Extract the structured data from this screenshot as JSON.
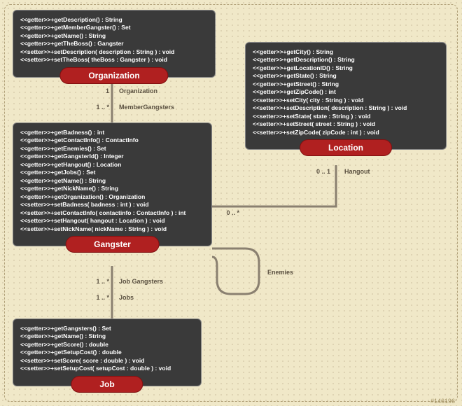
{
  "classes": {
    "organization": {
      "name": "Organization",
      "methods": [
        "<<getter>>+getDescription() : String",
        "<<getter>>+getMemberGangster() : Set",
        "<<getter>>+getName() : String",
        "<<getter>>+getTheBoss() : Gangster",
        "<<setter>>+setDescription( description : String ) : void",
        "<<setter>>+setTheBoss( theBoss : Gangster ) : void"
      ]
    },
    "gangster": {
      "name": "Gangster",
      "methods": [
        "<<getter>>+getBadness() : int",
        "<<getter>>+getContactInfo() : ContactInfo",
        "<<getter>>+getEnemies() : Set",
        "<<getter>>+getGangsterId() : Integer",
        "<<getter>>+getHangout() : Location",
        "<<getter>>+getJobs() : Set",
        "<<getter>>+getName() : String",
        "<<getter>>+getNickName() : String",
        "<<getter>>+getOrganization() : Organization",
        "<<setter>>+setBadness( badness : int ) : void",
        "<<setter>>+setContactInfo( contactinfo : ContactInfo ) : int",
        "<<setter>>+setHangout( hangout : Location ) : void",
        "<<setter>>+setNickName( nickName : String ) : void"
      ]
    },
    "location": {
      "name": "Location",
      "methods": [
        "<<getter>>+getCity() : String",
        "<<getter>>+getDescription() : String",
        "<<getter>>+getLocationID() : String",
        "<<getter>>+getState() : String",
        "<<getter>>+getStreet() : String",
        "<<getter>>+getZipCode() : int",
        "<<setter>>+setCity( city : String ) : void",
        "<<setter>>+setDescription( description : String ) : void",
        "<<setter>>+setState( state : String ) : void",
        "<<setter>>+setStreet( street : String ) : void",
        "<<setter>>+setZipCode( zipCode : int ) : void"
      ]
    },
    "job": {
      "name": "Job",
      "methods": [
        "<<getter>>+getGangsters() : Set",
        "<<getter>>+getName() : String",
        "<<getter>>+getScore() : double",
        "<<getter>>+getSetupCost() : double",
        "<<setter>>+setScore( score : double ) : void",
        "<<setter>>+setSetupCost( setupCost : double ) : void"
      ]
    }
  },
  "associations": {
    "org_gangster": {
      "end1_mult": "1",
      "end1_role": "Organization",
      "end2_mult": "1 .. *",
      "end2_role": "MemberGangsters"
    },
    "gangster_location": {
      "end1_mult": "0 .. *",
      "end2_mult": "0 .. 1",
      "end2_role": "Hangout"
    },
    "gangster_job": {
      "end1_mult": "1 .. *",
      "end1_role": "Job Gangsters",
      "end2_mult": "1 .. *",
      "end2_role": "Jobs"
    },
    "gangster_enemies": {
      "role": "Enemies"
    }
  },
  "watermark": "#146196"
}
